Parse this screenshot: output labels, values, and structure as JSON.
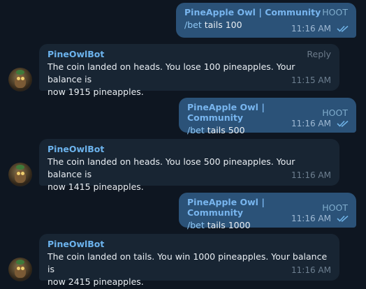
{
  "messages": [
    {
      "direction": "out",
      "sender": "PineApple Owl | Community",
      "tag": "HOOT",
      "command": "/bet",
      "text": " tails 100",
      "time": "11:16 AM",
      "status": "read-double-check"
    },
    {
      "direction": "in",
      "sender": "PineOwlBot",
      "action": "Reply",
      "line1": "The coin landed on heads. You lose 100 pineapples. Your balance is",
      "line2": "now 1915 pineapples.",
      "time": "11:15 AM"
    },
    {
      "direction": "out",
      "sender": "PineApple Owl | Community",
      "tag": "HOOT",
      "command": "/bet",
      "text": " tails 500",
      "time": "11:16 AM",
      "status": "read-double-check"
    },
    {
      "direction": "in",
      "sender": "PineOwlBot",
      "line1": "The coin landed on heads. You lose 500 pineapples. Your balance is",
      "line2": "now 1415 pineapples.",
      "time": "11:16 AM"
    },
    {
      "direction": "out",
      "sender": "PineApple Owl | Community",
      "tag": "HOOT",
      "command": "/bet",
      "text": " tails 1000",
      "time": "11:16 AM",
      "status": "read-double-check"
    },
    {
      "direction": "in",
      "sender": "PineOwlBot",
      "line1": "The coin landed on tails. You win 1000 pineapples. Your balance is",
      "line2": "now 2415 pineapples.",
      "time": "11:16 AM"
    }
  ],
  "avatar_icon": "owl-avatar-icon",
  "colors": {
    "background": "#0e1621",
    "outgoing": "#2b5278",
    "incoming": "#182533",
    "name": "#78b5ee"
  }
}
